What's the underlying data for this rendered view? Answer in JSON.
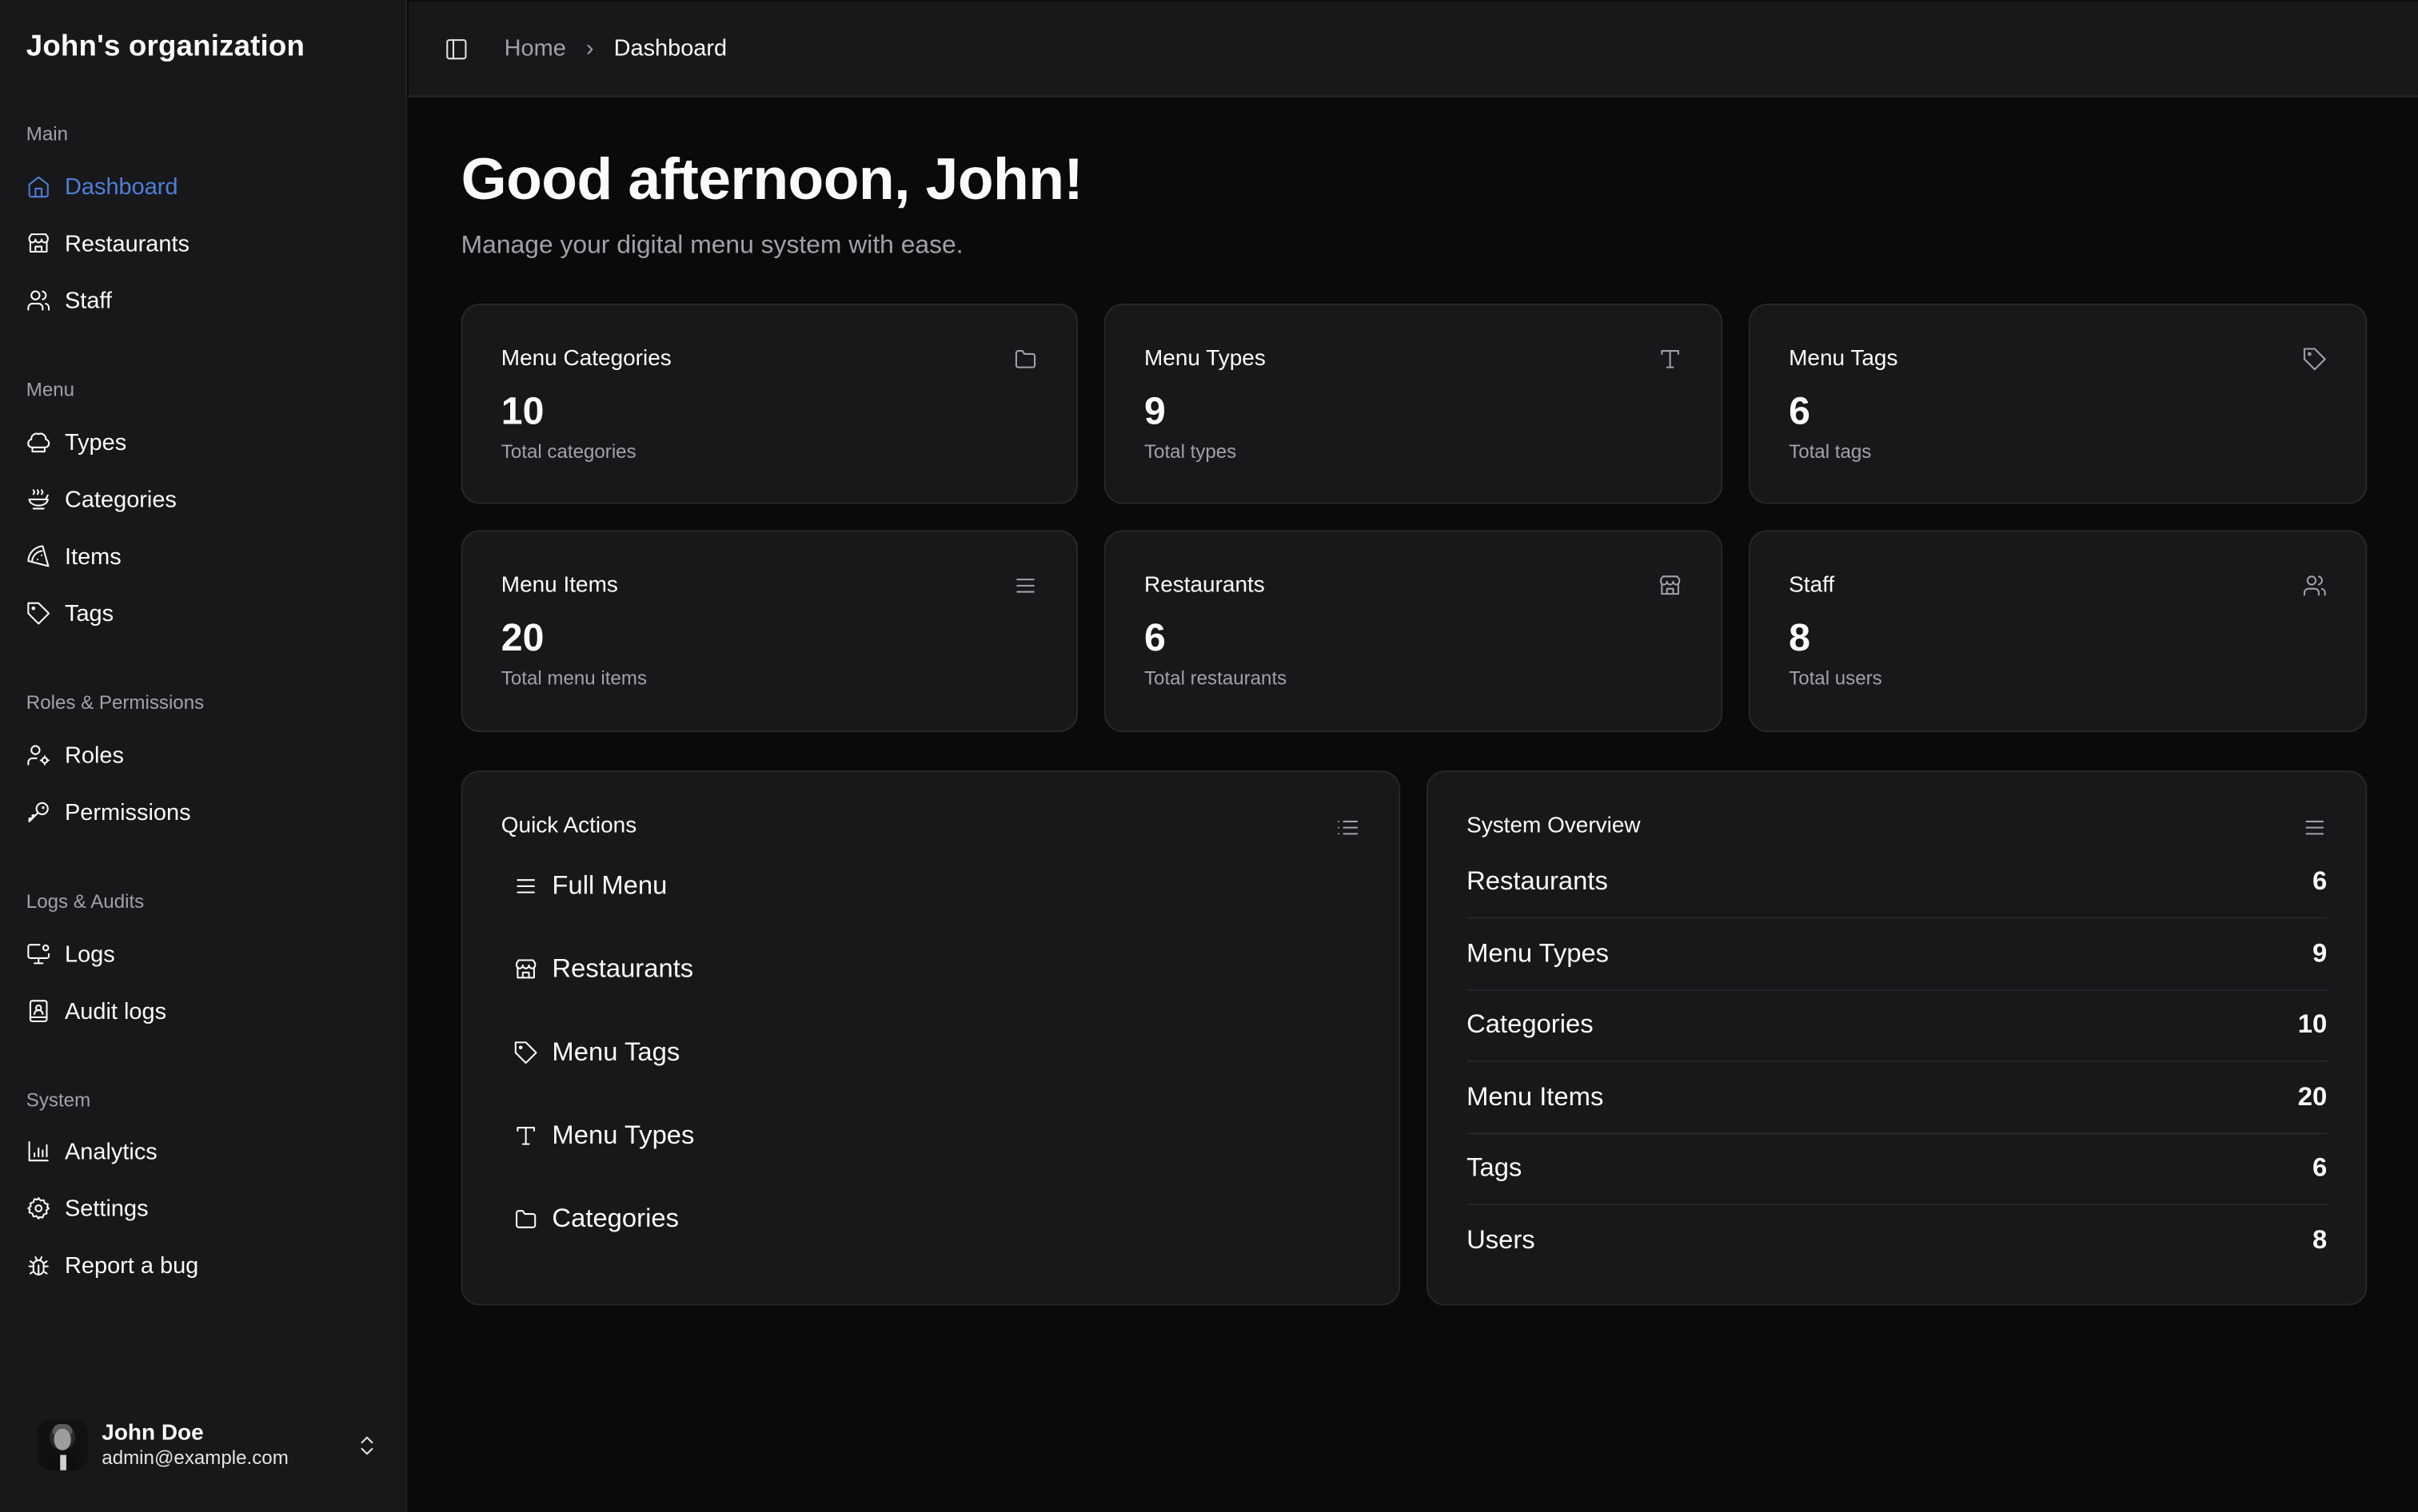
{
  "sidebar": {
    "org_name": "John's organization",
    "groups": [
      {
        "label": "Main",
        "items": [
          {
            "label": "Dashboard",
            "icon": "home-icon",
            "active": true
          },
          {
            "label": "Restaurants",
            "icon": "store-icon"
          },
          {
            "label": "Staff",
            "icon": "users-icon"
          }
        ]
      },
      {
        "label": "Menu",
        "items": [
          {
            "label": "Types",
            "icon": "chef-hat-icon"
          },
          {
            "label": "Categories",
            "icon": "soup-icon"
          },
          {
            "label": "Items",
            "icon": "pizza-icon"
          },
          {
            "label": "Tags",
            "icon": "tag-icon"
          }
        ]
      },
      {
        "label": "Roles & Permissions",
        "items": [
          {
            "label": "Roles",
            "icon": "user-cog-icon"
          },
          {
            "label": "Permissions",
            "icon": "key-icon"
          }
        ]
      },
      {
        "label": "Logs & Audits",
        "items": [
          {
            "label": "Logs",
            "icon": "monitor-cog-icon"
          },
          {
            "label": "Audit logs",
            "icon": "book-user-icon"
          }
        ]
      },
      {
        "label": "System",
        "items": [
          {
            "label": "Analytics",
            "icon": "bar-chart-icon"
          },
          {
            "label": "Settings",
            "icon": "settings-icon"
          },
          {
            "label": "Report a bug",
            "icon": "bug-icon"
          }
        ]
      }
    ],
    "user": {
      "name": "John Doe",
      "email": "admin@example.com"
    }
  },
  "header": {
    "breadcrumb": {
      "home": "Home",
      "separator": "›",
      "current": "Dashboard"
    }
  },
  "main": {
    "greeting": "Good afternoon, John!",
    "subtitle": "Manage your digital menu system with ease.",
    "stats": [
      {
        "title": "Menu Categories",
        "value": "10",
        "sub": "Total categories",
        "icon": "folder-icon"
      },
      {
        "title": "Menu Types",
        "value": "9",
        "sub": "Total types",
        "icon": "type-icon"
      },
      {
        "title": "Menu Tags",
        "value": "6",
        "sub": "Total tags",
        "icon": "tag-icon"
      },
      {
        "title": "Menu Items",
        "value": "20",
        "sub": "Total menu items",
        "icon": "menu-icon"
      },
      {
        "title": "Restaurants",
        "value": "6",
        "sub": "Total restaurants",
        "icon": "store-icon"
      },
      {
        "title": "Staff",
        "value": "8",
        "sub": "Total users",
        "icon": "users-icon"
      }
    ],
    "quick_actions": {
      "title": "Quick Actions",
      "items": [
        {
          "label": "Full Menu",
          "icon": "menu-icon"
        },
        {
          "label": "Restaurants",
          "icon": "store-icon"
        },
        {
          "label": "Menu Tags",
          "icon": "tag-icon"
        },
        {
          "label": "Menu Types",
          "icon": "type-icon"
        },
        {
          "label": "Categories",
          "icon": "folder-icon"
        }
      ]
    },
    "system_overview": {
      "title": "System Overview",
      "rows": [
        {
          "label": "Restaurants",
          "value": "6"
        },
        {
          "label": "Menu Types",
          "value": "9"
        },
        {
          "label": "Categories",
          "value": "10"
        },
        {
          "label": "Menu Items",
          "value": "20"
        },
        {
          "label": "Tags",
          "value": "6"
        },
        {
          "label": "Users",
          "value": "8"
        }
      ]
    }
  },
  "colors": {
    "accent": "#4f7fd8",
    "background": "#0a0a0a",
    "surface": "#18181b",
    "border": "#27272a",
    "muted_text": "#a1a1aa"
  }
}
